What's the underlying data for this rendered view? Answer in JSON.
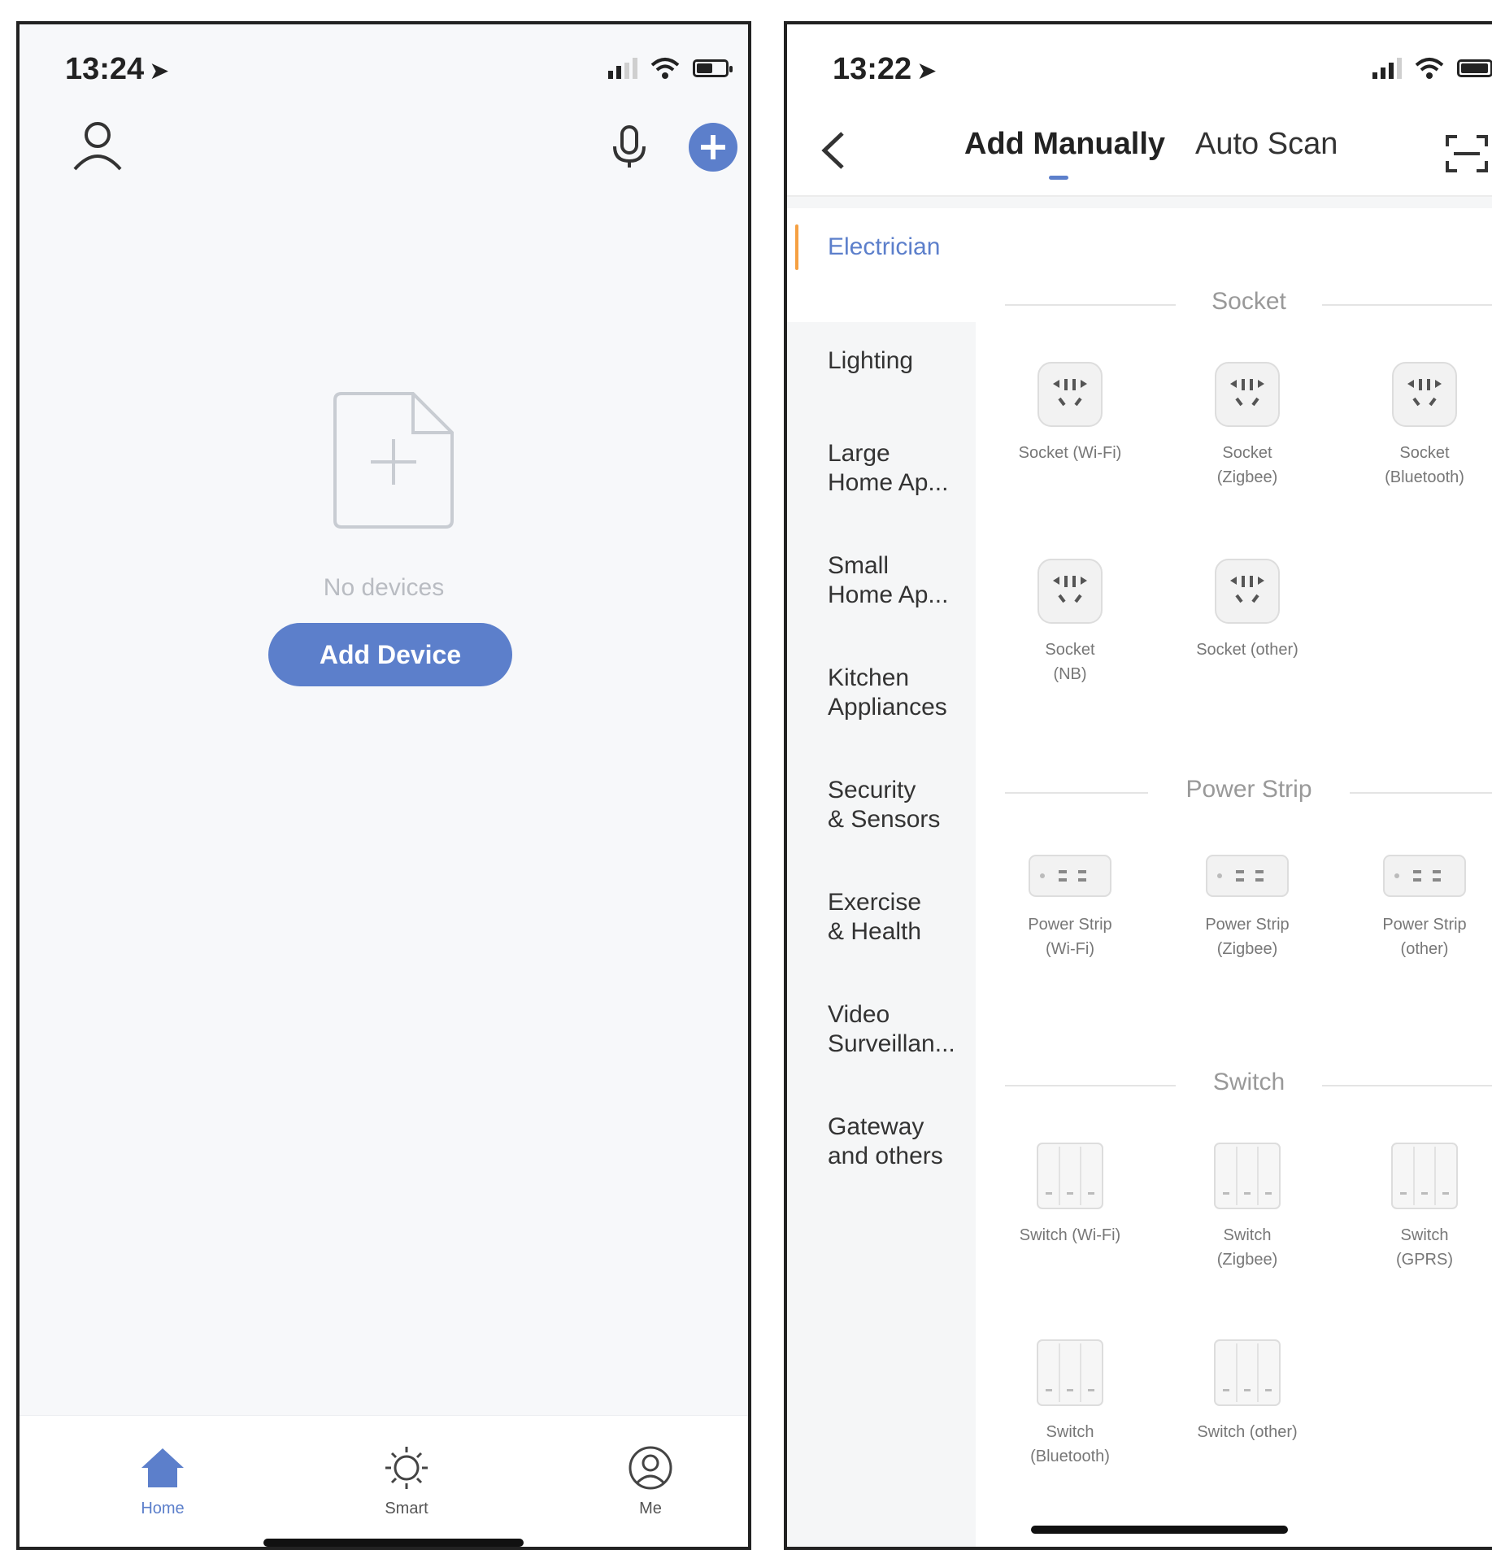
{
  "left_phone": {
    "status": {
      "time": "13:24"
    },
    "header": {
      "user_icon": "user-icon",
      "mic_icon": "microphone-icon",
      "add_icon": "plus-circle-icon"
    },
    "empty_state": {
      "message": "No devices",
      "button_label": "Add Device"
    },
    "tabbar": [
      {
        "id": "home",
        "label": "Home",
        "icon": "home-icon"
      },
      {
        "id": "smart",
        "label": "Smart",
        "icon": "sun-icon"
      },
      {
        "id": "me",
        "label": "Me",
        "icon": "user-circle-icon"
      }
    ]
  },
  "right_phone": {
    "status": {
      "time": "13:22"
    },
    "header": {
      "tab_manual": "Add Manually",
      "tab_scan": "Auto Scan"
    },
    "sidebar": [
      {
        "line1": "Electrician",
        "line2": ""
      },
      {
        "line1": "Lighting",
        "line2": ""
      },
      {
        "line1": "Large",
        "line2": "Home Ap..."
      },
      {
        "line1": "Small",
        "line2": "Home Ap..."
      },
      {
        "line1": "Kitchen",
        "line2": "Appliances"
      },
      {
        "line1": "Security",
        "line2": "& Sensors"
      },
      {
        "line1": "Exercise",
        "line2": "& Health"
      },
      {
        "line1": "Video",
        "line2": "Surveillan..."
      },
      {
        "line1": "Gateway",
        "line2": "and others"
      }
    ],
    "sections": [
      {
        "title": "Socket",
        "devices": [
          {
            "line1": "Socket (Wi-Fi)",
            "line2": ""
          },
          {
            "line1": "Socket",
            "line2": "(Zigbee)"
          },
          {
            "line1": "Socket",
            "line2": "(Bluetooth)"
          },
          {
            "line1": "Socket",
            "line2": "(NB)"
          },
          {
            "line1": "Socket (other)",
            "line2": ""
          }
        ]
      },
      {
        "title": "Power Strip",
        "devices": [
          {
            "line1": "Power Strip",
            "line2": "(Wi-Fi)"
          },
          {
            "line1": "Power Strip",
            "line2": "(Zigbee)"
          },
          {
            "line1": "Power Strip",
            "line2": "(other)"
          }
        ]
      },
      {
        "title": "Switch",
        "devices": [
          {
            "line1": "Switch (Wi-Fi)",
            "line2": ""
          },
          {
            "line1": "Switch",
            "line2": "(Zigbee)"
          },
          {
            "line1": "Switch",
            "line2": "(GPRS)"
          },
          {
            "line1": "Switch",
            "line2": "(Bluetooth)"
          },
          {
            "line1": "Switch (other)",
            "line2": ""
          }
        ]
      }
    ]
  },
  "colors": {
    "accent": "#5c7fcb",
    "sidebar_marker": "#f5a042"
  }
}
